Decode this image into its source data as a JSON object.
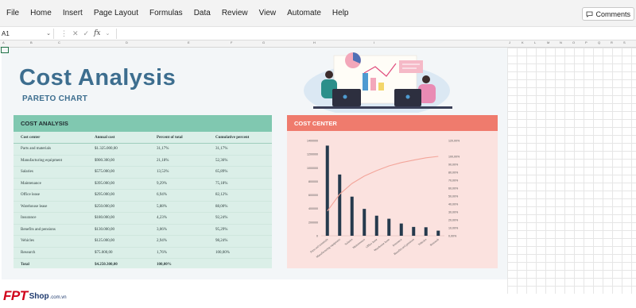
{
  "menu": {
    "items": [
      "File",
      "Home",
      "Insert",
      "Page Layout",
      "Formulas",
      "Data",
      "Review",
      "View",
      "Automate",
      "Help"
    ],
    "comments_label": "Comments"
  },
  "formula_bar": {
    "name_box": "A1",
    "fx_label": "fx",
    "value": ""
  },
  "columns": [
    "A",
    "B",
    "C",
    "D",
    "E",
    "F",
    "G",
    "H",
    "I",
    "J",
    "K",
    "L",
    "M",
    "N",
    "O",
    "P",
    "Q",
    "R",
    "S"
  ],
  "report": {
    "title": "Cost Analysis",
    "subtitle": "PARETO CHART"
  },
  "table": {
    "heading": "COST ANALYSIS",
    "headers": [
      "Cost center",
      "Annual cost",
      "Percent of total",
      "Cumulative percent"
    ],
    "rows": [
      [
        "Parts and materials",
        "$1.325.000,00",
        "31,17%",
        "31,17%"
      ],
      [
        "Manufacturing equipment",
        "$900.300,00",
        "21,18%",
        "52,36%"
      ],
      [
        "Salaries",
        "$575.000,00",
        "13,53%",
        "65,89%"
      ],
      [
        "Maintenance",
        "$395.000,00",
        "9,29%",
        "75,18%"
      ],
      [
        "Office lease",
        "$295.000,00",
        "6,94%",
        "82,12%"
      ],
      [
        "Warehouse lease",
        "$250.000,00",
        "5,88%",
        "88,00%"
      ],
      [
        "Insurance",
        "$180.000,00",
        "4,23%",
        "92,24%"
      ],
      [
        "Benefits and pensions",
        "$130.000,00",
        "3,06%",
        "95,29%"
      ],
      [
        "Vehicles",
        "$125.000,00",
        "2,94%",
        "98,24%"
      ],
      [
        "Research",
        "$75.000,00",
        "1,76%",
        "100,00%"
      ]
    ],
    "total": [
      "Total",
      "$4.250.300,00",
      "100,00%",
      ""
    ]
  },
  "chart_heading": "COST CENTER",
  "chart_data": {
    "type": "bar",
    "categories": [
      "Parts and materials",
      "Manufacturing equipment",
      "Salaries",
      "Maintenance",
      "Office lease",
      "Warehouse lease",
      "Insurance",
      "Benefits and pensions",
      "Vehicles",
      "Research"
    ],
    "series": [
      {
        "values": [
          1325000,
          900300,
          575000,
          395000,
          295000,
          250000,
          180000,
          130000,
          125000,
          75000
        ]
      },
      {
        "values": [
          31.17,
          52.36,
          65.89,
          75.18,
          82.12,
          88.0,
          92.24,
          95.29,
          98.24,
          100.0
        ]
      }
    ],
    "y_ticks": [
      "0",
      "200000",
      "400000",
      "600000",
      "800000",
      "1000000",
      "1200000",
      "1400000"
    ],
    "ylim": [
      0,
      1400000
    ],
    "y2_ticks": [
      "0,00%",
      "10,00%",
      "20,00%",
      "30,00%",
      "40,00%",
      "50,00%",
      "60,00%",
      "70,00%",
      "80,00%",
      "90,00%",
      "100,00%",
      "120,00%"
    ],
    "y2lim": [
      0,
      120
    ],
    "colors": {
      "bars": "#253a4d",
      "line": "#f3a59a",
      "header": "#ef7b6d",
      "panel": "#fbe2df"
    }
  },
  "brand": {
    "logo": "FPT",
    "shop": "Shop",
    "domain": ".com.vn"
  }
}
